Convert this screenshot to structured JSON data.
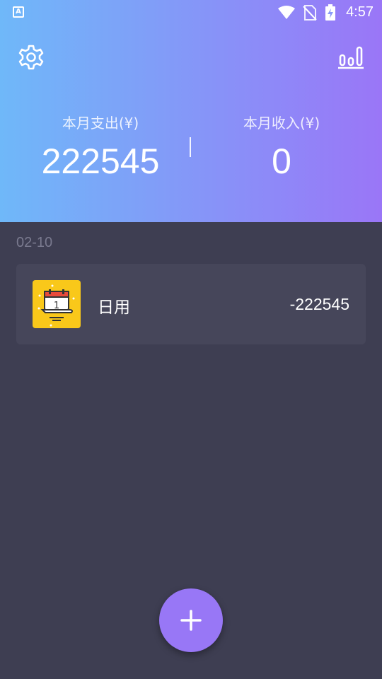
{
  "status_bar": {
    "app_indicator": "A",
    "time": "4:57"
  },
  "summary": {
    "expense_label": "本月支出(¥)",
    "expense_value": "222545",
    "income_label": "本月收入(¥)",
    "income_value": "0"
  },
  "records": {
    "date": "02-10",
    "items": [
      {
        "category": "日用",
        "amount": "-222545",
        "icon": "calendar-icon"
      }
    ]
  },
  "icons": {
    "settings": "gear-icon",
    "stats": "bar-chart-icon",
    "add": "plus-icon"
  },
  "colors": {
    "header_start": "#6fb8f9",
    "header_end": "#9a76f7",
    "background": "#3e3e52",
    "card": "#46465a",
    "fab": "#9877f6",
    "category_icon_bg": "#f9c81a"
  }
}
